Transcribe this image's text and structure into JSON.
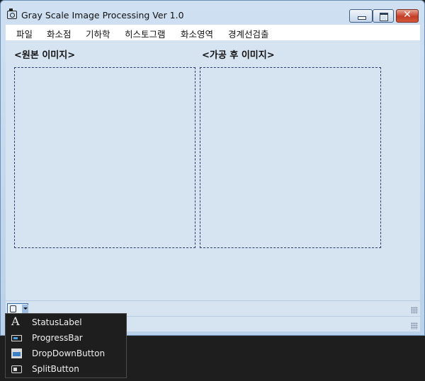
{
  "window": {
    "title": "Gray Scale Image Processing Ver 1.0"
  },
  "menu": {
    "items": [
      "파일",
      "화소점",
      "기하학",
      "히스토그램",
      "화소영역",
      "경계선검출"
    ]
  },
  "panels": {
    "original_caption": "<원본 이미지>",
    "processed_caption": "<가공 후 이미지>"
  },
  "statusstrip": {
    "add_item_icon": "add-statusstrip-item-icon"
  },
  "popup": {
    "items": [
      {
        "label": "StatusLabel",
        "icon": "status-label-icon"
      },
      {
        "label": "ProgressBar",
        "icon": "progress-bar-icon"
      },
      {
        "label": "DropDownButton",
        "icon": "dropdown-button-icon"
      },
      {
        "label": "SplitButton",
        "icon": "split-button-icon"
      }
    ]
  },
  "colors": {
    "client_background": "#d6e4f2",
    "close_button": "#c43c26",
    "popup_background": "#1e1e1e"
  }
}
